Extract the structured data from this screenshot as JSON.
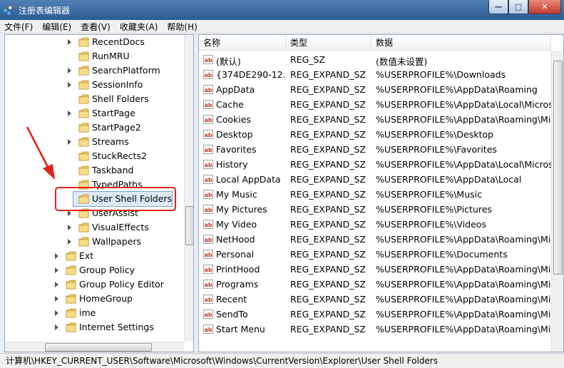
{
  "window": {
    "title": "注册表编辑器",
    "minimize": "—",
    "maximize": "□",
    "close": "✕"
  },
  "menu": [
    "文件(F)",
    "编辑(E)",
    "查看(V)",
    "收藏夹(A)",
    "帮助(H)"
  ],
  "tree": {
    "items": [
      {
        "label": "RecentDocs",
        "level": 2,
        "expandable": true
      },
      {
        "label": "RunMRU",
        "level": 2,
        "expandable": false
      },
      {
        "label": "SearchPlatform",
        "level": 2,
        "expandable": true
      },
      {
        "label": "SessionInfo",
        "level": 2,
        "expandable": true
      },
      {
        "label": "Shell Folders",
        "level": 2,
        "expandable": false
      },
      {
        "label": "StartPage",
        "level": 2,
        "expandable": true
      },
      {
        "label": "StartPage2",
        "level": 2,
        "expandable": false
      },
      {
        "label": "Streams",
        "level": 2,
        "expandable": true
      },
      {
        "label": "StuckRects2",
        "level": 2,
        "expandable": false
      },
      {
        "label": "Taskband",
        "level": 2,
        "expandable": false
      },
      {
        "label": "TypedPaths",
        "level": 2,
        "expandable": false
      },
      {
        "label": "User Shell Folders",
        "level": 2,
        "expandable": false,
        "selected": true
      },
      {
        "label": "UserAssist",
        "level": 2,
        "expandable": true
      },
      {
        "label": "VisualEffects",
        "level": 2,
        "expandable": true
      },
      {
        "label": "Wallpapers",
        "level": 2,
        "expandable": true
      },
      {
        "label": "Ext",
        "level": 1,
        "expandable": true
      },
      {
        "label": "Group Policy",
        "level": 1,
        "expandable": true
      },
      {
        "label": "Group Policy Editor",
        "level": 1,
        "expandable": true
      },
      {
        "label": "HomeGroup",
        "level": 1,
        "expandable": true
      },
      {
        "label": "ime",
        "level": 1,
        "expandable": true
      },
      {
        "label": "Internet Settings",
        "level": 1,
        "expandable": true
      }
    ]
  },
  "values": {
    "columns": [
      "名称",
      "类型",
      "数据"
    ],
    "rows": [
      {
        "name": "(默认)",
        "type": "REG_SZ",
        "data": "(数值未设置)"
      },
      {
        "name": "{374DE290-12...",
        "type": "REG_EXPAND_SZ",
        "data": "%USERPROFILE%\\Downloads"
      },
      {
        "name": "AppData",
        "type": "REG_EXPAND_SZ",
        "data": "%USERPROFILE%\\AppData\\Roaming"
      },
      {
        "name": "Cache",
        "type": "REG_EXPAND_SZ",
        "data": "%USERPROFILE%\\AppData\\Local\\Microso"
      },
      {
        "name": "Cookies",
        "type": "REG_EXPAND_SZ",
        "data": "%USERPROFILE%\\AppData\\Roaming\\Micr"
      },
      {
        "name": "Desktop",
        "type": "REG_EXPAND_SZ",
        "data": "%USERPROFILE%\\Desktop"
      },
      {
        "name": "Favorites",
        "type": "REG_EXPAND_SZ",
        "data": "%USERPROFILE%\\Favorites"
      },
      {
        "name": "History",
        "type": "REG_EXPAND_SZ",
        "data": "%USERPROFILE%\\AppData\\Local\\Microso"
      },
      {
        "name": "Local AppData",
        "type": "REG_EXPAND_SZ",
        "data": "%USERPROFILE%\\AppData\\Local"
      },
      {
        "name": "My Music",
        "type": "REG_EXPAND_SZ",
        "data": "%USERPROFILE%\\Music"
      },
      {
        "name": "My Pictures",
        "type": "REG_EXPAND_SZ",
        "data": "%USERPROFILE%\\Pictures"
      },
      {
        "name": "My Video",
        "type": "REG_EXPAND_SZ",
        "data": "%USERPROFILE%\\Videos"
      },
      {
        "name": "NetHood",
        "type": "REG_EXPAND_SZ",
        "data": "%USERPROFILE%\\AppData\\Roaming\\Micr"
      },
      {
        "name": "Personal",
        "type": "REG_EXPAND_SZ",
        "data": "%USERPROFILE%\\Documents"
      },
      {
        "name": "PrintHood",
        "type": "REG_EXPAND_SZ",
        "data": "%USERPROFILE%\\AppData\\Roaming\\Micr"
      },
      {
        "name": "Programs",
        "type": "REG_EXPAND_SZ",
        "data": "%USERPROFILE%\\AppData\\Roaming\\Micr"
      },
      {
        "name": "Recent",
        "type": "REG_EXPAND_SZ",
        "data": "%USERPROFILE%\\AppData\\Roaming\\Micr"
      },
      {
        "name": "SendTo",
        "type": "REG_EXPAND_SZ",
        "data": "%USERPROFILE%\\AppData\\Roaming\\Micr"
      },
      {
        "name": "Start Menu",
        "type": "REG_EXPAND_SZ",
        "data": "%USERPROFILE%\\AppData\\Roaming\\Micr"
      }
    ]
  },
  "status": "计算机\\HKEY_CURRENT_USER\\Software\\Microsoft\\Windows\\CurrentVersion\\Explorer\\User Shell Folders",
  "icons": {
    "app": "registry-icon",
    "folder": "folder-icon",
    "value": "string-value-icon",
    "expander": "expander-arrow-icon",
    "annotation": "red-arrow-icon"
  },
  "colors": {
    "highlight": "#e0201b",
    "folder": "#f2c85b",
    "selection": "#dceaf8"
  }
}
